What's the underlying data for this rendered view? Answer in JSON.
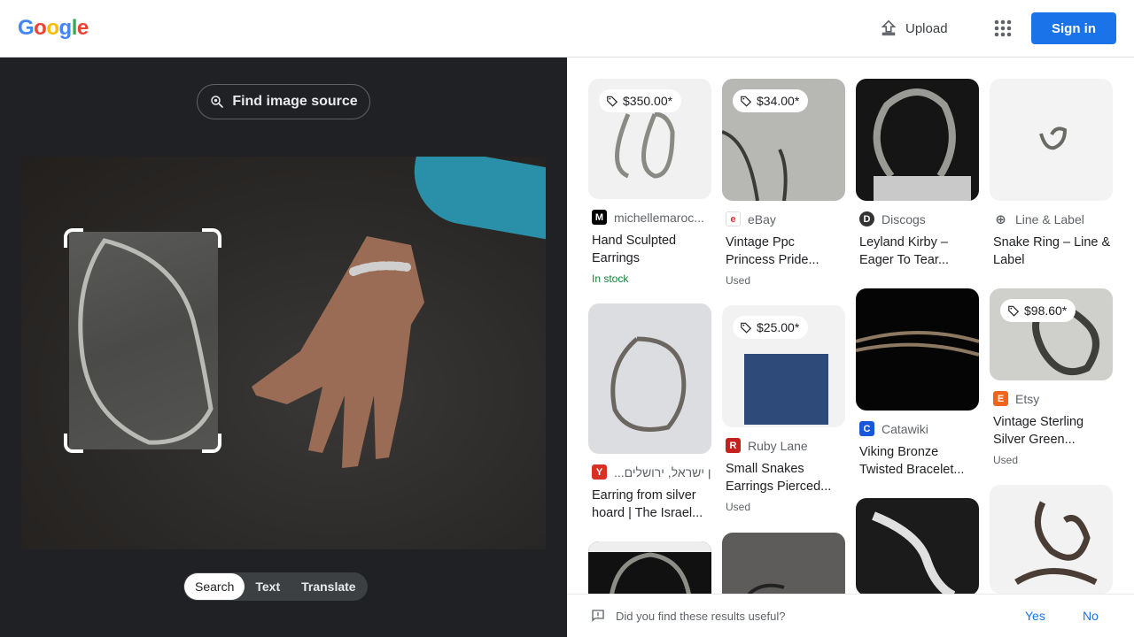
{
  "header": {
    "logo_letters": [
      {
        "ch": "G",
        "color": "#4285F4"
      },
      {
        "ch": "o",
        "color": "#EA4335"
      },
      {
        "ch": "o",
        "color": "#FBBC05"
      },
      {
        "ch": "g",
        "color": "#4285F4"
      },
      {
        "ch": "l",
        "color": "#34A853"
      },
      {
        "ch": "e",
        "color": "#EA4335"
      }
    ],
    "upload_label": "Upload",
    "signin_label": "Sign in"
  },
  "left": {
    "find_source_label": "Find image source",
    "tabs": [
      "Search",
      "Text",
      "Translate"
    ]
  },
  "results": [
    {
      "price": "$350.00*",
      "source": "michellemaroc...",
      "icon": "M",
      "icon_color": "#000000",
      "title": "Hand Sculpted Earrings",
      "meta": "In stock",
      "meta_green": true
    },
    {
      "price": "$34.00*",
      "source": "eBay",
      "icon": "e",
      "icon_color": "#e53238",
      "title": "Vintage Ppc Princess Pride...",
      "meta": "Used"
    },
    {
      "price": "",
      "source": "Discogs",
      "icon": "D",
      "icon_color": "#333333",
      "title": "Leyland Kirby – Eager To Tear...",
      "meta": ""
    },
    {
      "price": "",
      "source": "Line & Label",
      "icon": "⊕",
      "icon_color": "#5f6368",
      "title": "Snake Ring – Line & Label",
      "meta": ""
    },
    {
      "price": "",
      "source": "...ן ישראל, ירושלים",
      "icon": "Y",
      "icon_color": "#d93025",
      "title": "Earring from silver hoard | The Israel...",
      "meta": ""
    },
    {
      "price": "$25.00*",
      "source": "Ruby Lane",
      "icon": "R",
      "icon_color": "#c5221f",
      "title": "Small Snakes Earrings Pierced...",
      "meta": "Used"
    },
    {
      "price": "",
      "source": "Catawiki",
      "icon": "C",
      "icon_color": "#1a56db",
      "title": "Viking Bronze Twisted Bracelet...",
      "meta": ""
    },
    {
      "price": "$98.60*",
      "source": "Etsy",
      "icon": "E",
      "icon_color": "#f1641e",
      "title": "Vintage Sterling Silver Green...",
      "meta": "Used"
    }
  ],
  "feedback": {
    "question": "Did you find these results useful?",
    "yes": "Yes",
    "no": "No"
  }
}
